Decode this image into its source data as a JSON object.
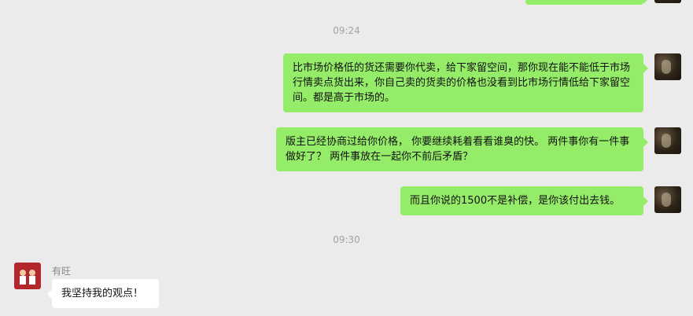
{
  "chat": {
    "top_bubble": "",
    "times": [
      "09:24",
      "09:30"
    ],
    "messages": [
      "比市场价格低的货还需要你代卖，给下家留空间，那你现在能不能低于市场行情卖点货出来，你自己卖的货卖的价格也没看到比市场行情低给下家留空间。都是高于市场的。",
      "版主已经协商过给你价格， 你要继续耗着看看谁臭的快。 两件事你有一件事做好了？ 两件事放在一起你不前后矛盾？",
      "而且你说的1500不是补偿，是你该付出去钱。",
      "我坚持我的观点！"
    ],
    "sender_name": "有旺"
  },
  "colors": {
    "my_bubble": "#95ec69",
    "their_bubble": "#ffffff",
    "background": "#ebebeb"
  }
}
